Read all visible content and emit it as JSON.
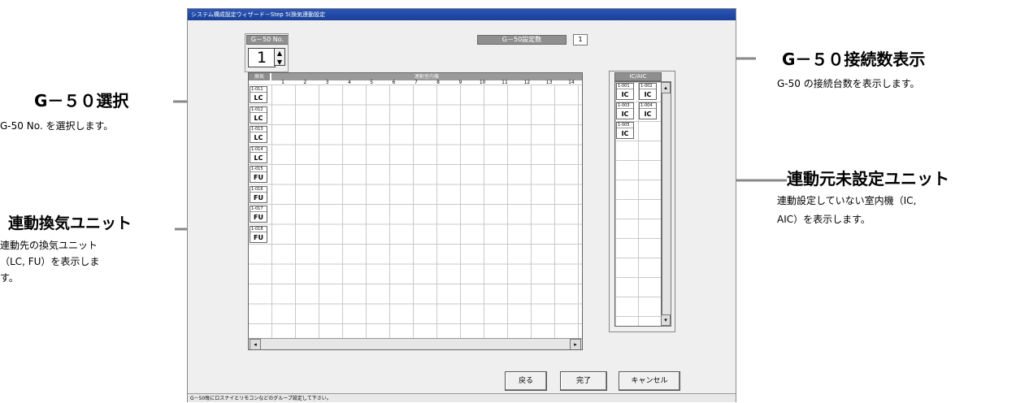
{
  "window": {
    "title": "システム構成設定ウィザード－Step 5(換気連動設定",
    "status_text": "G－50毎にロスナイとリモコンなどのグループ設定して下さい。"
  },
  "g50_selector": {
    "label": "G－50 No.",
    "value": "1",
    "spin_up": "▲",
    "spin_down": "▼"
  },
  "g50_count": {
    "label": "G－50設定数",
    "value": "1"
  },
  "grid": {
    "vent_header": "換気",
    "indoor_header": "連動室内機",
    "columns": [
      "1",
      "2",
      "3",
      "4",
      "5",
      "6",
      "7",
      "8",
      "9",
      "10",
      "11",
      "12",
      "13",
      "14"
    ],
    "units": [
      {
        "id": "1-011",
        "type": "LC"
      },
      {
        "id": "1-012",
        "type": "LC"
      },
      {
        "id": "1-013",
        "type": "LC"
      },
      {
        "id": "1-014",
        "type": "LC"
      },
      {
        "id": "1-015",
        "type": "FU"
      },
      {
        "id": "1-016",
        "type": "FU"
      },
      {
        "id": "1-017",
        "type": "FU"
      },
      {
        "id": "1-018",
        "type": "FU"
      }
    ]
  },
  "ic_panel": {
    "header": "IC/AIC",
    "units": [
      {
        "id": "1-001",
        "type": "IC"
      },
      {
        "id": "1-002",
        "type": "IC"
      },
      {
        "id": "1-003",
        "type": "IC"
      },
      {
        "id": "1-004",
        "type": "IC"
      },
      {
        "id": "1-005",
        "type": "IC"
      }
    ]
  },
  "buttons": {
    "back": "戻る",
    "finish": "完了",
    "cancel": "キャンセル"
  },
  "annotations": {
    "g50_select_title": "G－５０選択",
    "g50_select_desc": "G-50 No. を選択します。",
    "vent_title": "連動換気ユニット",
    "vent_desc_1": "連動先の換気ユニット",
    "vent_desc_2": "（LC, FU）を表示しま",
    "vent_desc_3": "す。",
    "count_title": "G－５０接続数表示",
    "count_desc": "G-50 の接続台数を表示します。",
    "unset_title": "連動元未設定ユニット",
    "unset_desc_1": "連動設定していない室内機（IC,",
    "unset_desc_2": "AIC）を表示します。"
  }
}
